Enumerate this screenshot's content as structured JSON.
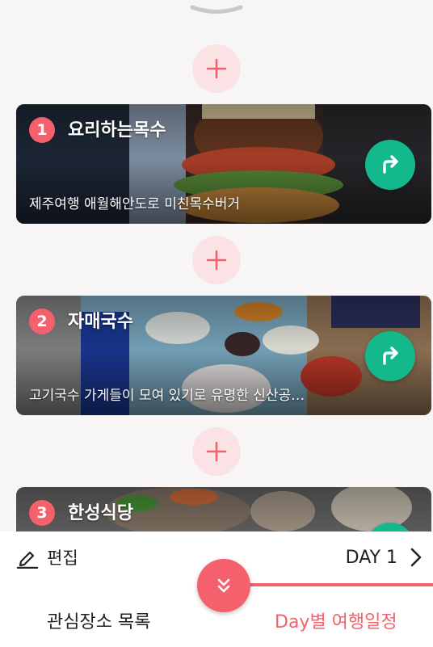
{
  "icons": {
    "handle": "chevron-down-handle",
    "add": "plus-icon",
    "route": "turn-right-arrow-icon",
    "edit": "pencil-icon",
    "next": "chevron-right-icon",
    "toggle": "double-chevron-down-icon"
  },
  "colors": {
    "accent": "#f4606c",
    "add_bg": "#fbe3e5",
    "route": "#14b88d"
  },
  "places": [
    {
      "number": "1",
      "title": "요리하는목수",
      "desc": "제주여행 애월해안도로 미친목수버거"
    },
    {
      "number": "2",
      "title": "자매국수",
      "desc": "고기국수 가게들이 모여 있기로 유명한 신산공…"
    },
    {
      "number": "3",
      "title": "한성식당",
      "desc": ""
    }
  ],
  "editbar": {
    "edit_label": "편집",
    "day_label": "DAY 1"
  },
  "tabs": {
    "left": "관심장소 목록",
    "right": "Day별 여행일정"
  }
}
